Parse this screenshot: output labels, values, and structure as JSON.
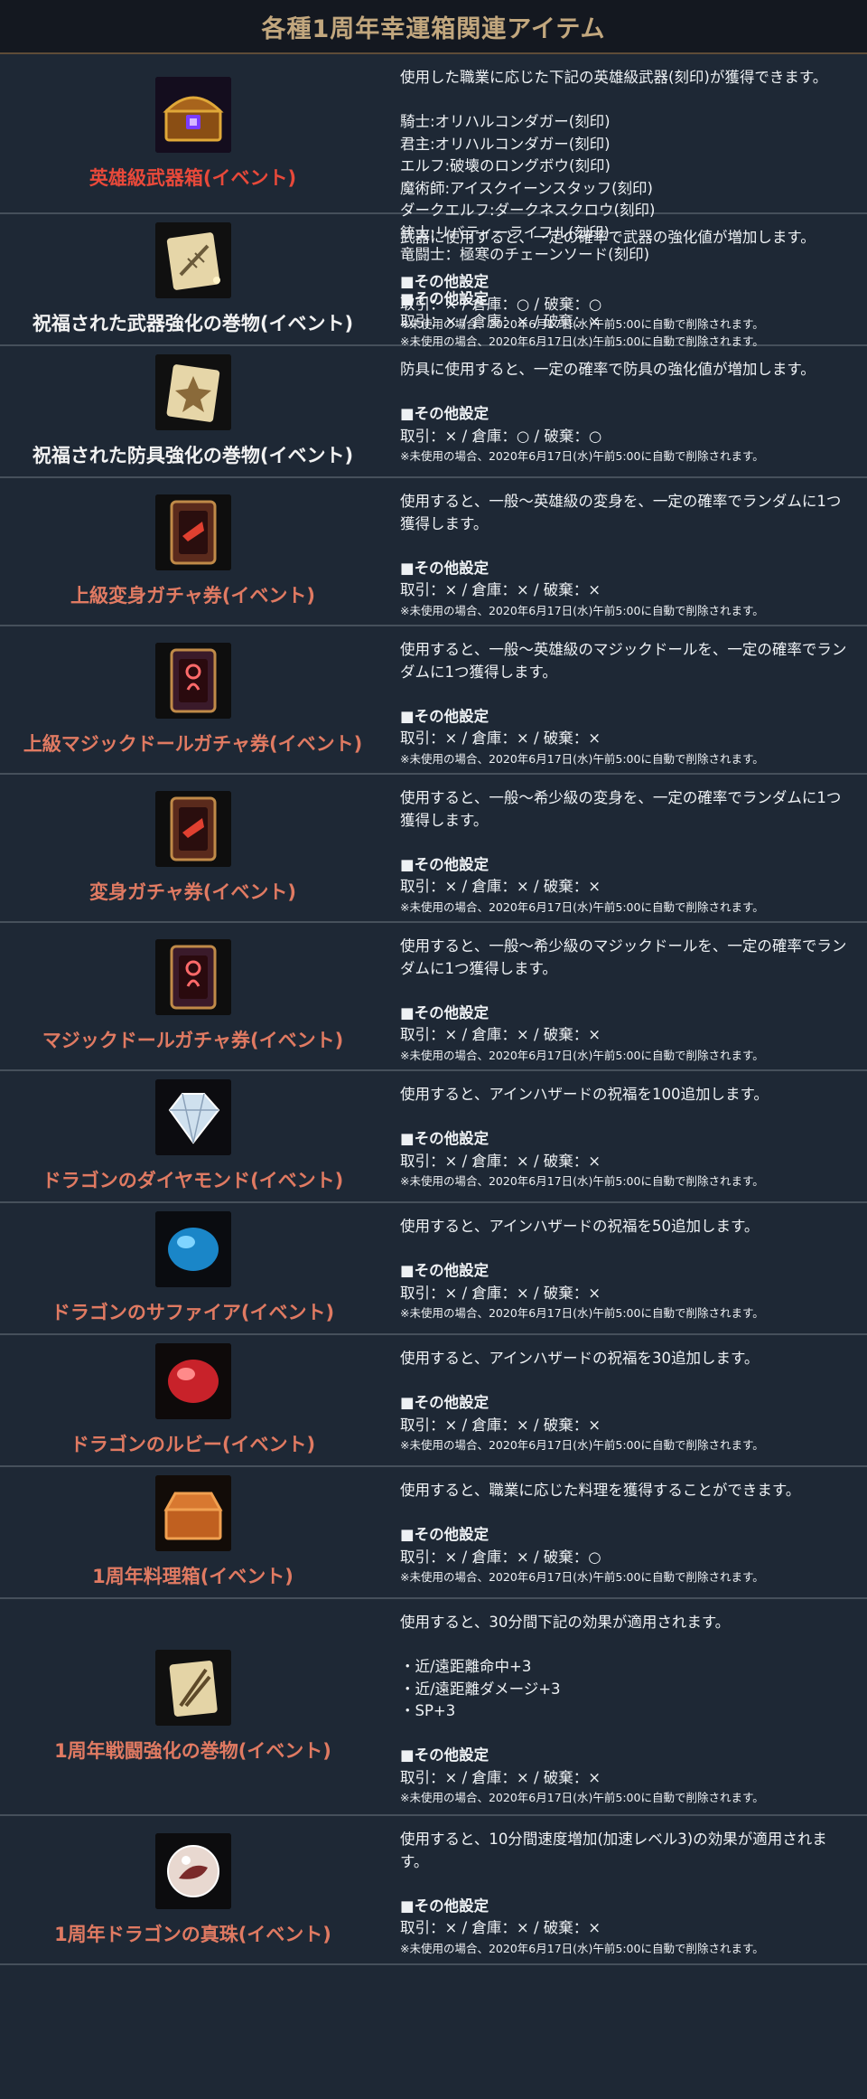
{
  "title": "各種1周年幸運箱関連アイテム",
  "labels": {
    "other_settings": "■その他設定",
    "note": "※未使用の場合、2020年6月17日(水)午前5:00に自動で削除されます。"
  },
  "items": [
    {
      "name": "英雄級武器箱(イベント)",
      "name_color": "#e8493a",
      "icon": "treasure-chest-icon",
      "desc": [
        "使用した職業に応じた下記の英雄級武器(刻印)が獲得できます。"
      ],
      "list": [
        "騎士:オリハルコンダガー(刻印)",
        "君主:オリハルコンダガー(刻印)",
        "エルフ:破壊のロングボウ(刻印)",
        "魔術師:アイスクイーンスタッフ(刻印)",
        "ダークエルフ:ダークネスクロウ(刻印)",
        "銃士:リバティーライフル(刻印)",
        "竜闘士：極寒のチェーンソード(刻印)"
      ],
      "trade": "取引：× / 倉庫：× / 破棄：×"
    },
    {
      "name": "祝福された武器強化の巻物(イベント)",
      "name_color": "#f2f2f2",
      "icon": "weapon-scroll-icon",
      "desc": [
        "武器に使用すると、一定の確率で武器の強化値が増加します。"
      ],
      "list": [],
      "trade": "取引：× / 倉庫：○ / 破棄：○"
    },
    {
      "name": "祝福された防具強化の巻物(イベント)",
      "name_color": "#f2f2f2",
      "icon": "armor-scroll-icon",
      "desc": [
        "防具に使用すると、一定の確率で防具の強化値が増加します。"
      ],
      "list": [],
      "trade": "取引：× / 倉庫：○ / 破棄：○"
    },
    {
      "name": "上級変身ガチャ券(イベント)",
      "name_color": "#e07a62",
      "icon": "polymorph-ticket-icon",
      "desc": [
        "使用すると、一般～英雄級の変身を、一定の確率でランダムに1つ",
        "獲得します。"
      ],
      "list": [],
      "trade": "取引：× / 倉庫：× / 破棄：×"
    },
    {
      "name": "上級マジックドールガチャ券(イベント)",
      "name_color": "#e07a62",
      "icon": "magic-doll-ticket-icon",
      "desc": [
        "使用すると、一般～英雄級のマジックドールを、一定の確率でラン",
        "ダムに1つ獲得します。"
      ],
      "list": [],
      "trade": "取引：× / 倉庫：× / 破棄：×"
    },
    {
      "name": "変身ガチャ券(イベント)",
      "name_color": "#e07a62",
      "icon": "polymorph-ticket-icon",
      "desc": [
        "使用すると、一般～希少級の変身を、一定の確率でランダムに1つ",
        "獲得します。"
      ],
      "list": [],
      "trade": "取引：× / 倉庫：× / 破棄：×"
    },
    {
      "name": "マジックドールガチャ券(イベント)",
      "name_color": "#e07a62",
      "icon": "magic-doll-ticket-icon",
      "desc": [
        "使用すると、一般～希少級のマジックドールを、一定の確率でラン",
        "ダムに1つ獲得します。"
      ],
      "list": [],
      "trade": "取引：× / 倉庫：× / 破棄：×"
    },
    {
      "name": "ドラゴンのダイヤモンド(イベント)",
      "name_color": "#e07a62",
      "icon": "diamond-icon",
      "desc": [
        "使用すると、アインハザードの祝福を100追加します。"
      ],
      "list": [],
      "trade": "取引：× / 倉庫：× / 破棄：×"
    },
    {
      "name": "ドラゴンのサファイア(イベント)",
      "name_color": "#e07a62",
      "icon": "sapphire-icon",
      "desc": [
        "使用すると、アインハザードの祝福を50追加します。"
      ],
      "list": [],
      "trade": "取引：× / 倉庫：× / 破棄：×"
    },
    {
      "name": "ドラゴンのルビー(イベント)",
      "name_color": "#e07a62",
      "icon": "ruby-icon",
      "desc": [
        "使用すると、アインハザードの祝福を30追加します。"
      ],
      "list": [],
      "trade": "取引：× / 倉庫：× / 破棄：×"
    },
    {
      "name": "1周年料理箱(イベント)",
      "name_color": "#e07a62",
      "icon": "cooking-box-icon",
      "desc": [
        "使用すると、職業に応じた料理を獲得することができます。"
      ],
      "list": [],
      "trade": "取引：× / 倉庫：× / 破棄：○"
    },
    {
      "name": "1周年戦闘強化の巻物(イベント)",
      "name_color": "#e07a62",
      "icon": "battle-scroll-icon",
      "desc": [
        "使用すると、30分間下記の効果が適用されます。"
      ],
      "list": [
        "・近/遠距離命中+3",
        "・近/遠距離ダメージ+3",
        "・SP+3"
      ],
      "trade": "取引：× / 倉庫：× / 破棄：×"
    },
    {
      "name": "1周年ドラゴンの真珠(イベント)",
      "name_color": "#e07a62",
      "icon": "dragon-pearl-icon",
      "desc": [
        "使用すると、10分間速度増加(加速レベル3)の効果が適用されま",
        "す。"
      ],
      "list": [],
      "trade": "取引：× / 倉庫：× / 破棄：×"
    }
  ]
}
